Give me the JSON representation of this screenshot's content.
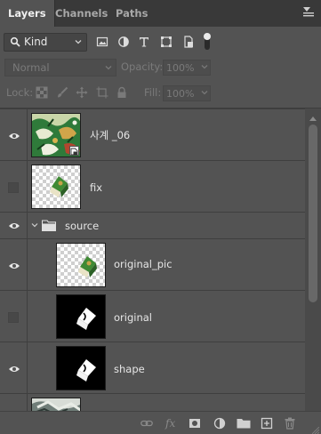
{
  "tabs": [
    {
      "label": "Layers"
    },
    {
      "label": "Channels"
    },
    {
      "label": "Paths"
    }
  ],
  "filter": {
    "kind_label": "Kind",
    "icons": [
      "image-filter-icon",
      "adjustment-filter-icon",
      "type-filter-icon",
      "shape-filter-icon",
      "smart-object-filter-icon"
    ]
  },
  "blend": {
    "mode": "Normal",
    "opacity_label": "Opacity:",
    "opacity_value": "100%"
  },
  "lock": {
    "label": "Lock:",
    "fill_label": "Fill:",
    "fill_value": "100%"
  },
  "layers": [
    {
      "name": "사계 _06",
      "visible": true
    },
    {
      "name": "fix",
      "visible": false
    },
    {
      "name": "source",
      "visible": true,
      "group": true,
      "expanded": true
    },
    {
      "name": "original_pic",
      "visible": true
    },
    {
      "name": "original",
      "visible": false
    },
    {
      "name": "shape",
      "visible": true
    }
  ],
  "bottom_bar": {
    "icons": [
      "link-layers-icon",
      "layer-style-icon",
      "layer-mask-icon",
      "adjustment-layer-icon",
      "new-group-icon",
      "new-layer-icon",
      "delete-layer-icon"
    ]
  },
  "colors": {
    "panel_bg": "#535353",
    "tab_bar_bg": "#393939",
    "text": "#d6d6d6",
    "active_tab_text": "#f0f0f0",
    "disabled_text": "#7a7a7a"
  }
}
